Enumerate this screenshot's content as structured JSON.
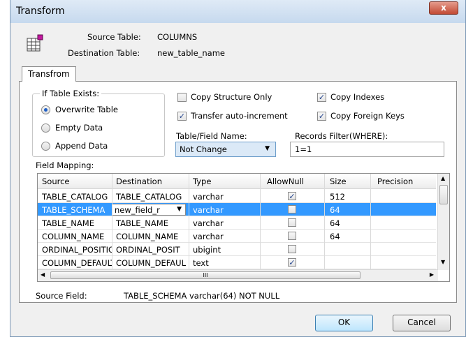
{
  "window": {
    "title": "Transform",
    "close_label": "x"
  },
  "header": {
    "source_label": "Source Table:",
    "source_value": "COLUMNS",
    "dest_label": "Destination Table:",
    "dest_value": "new_table_name"
  },
  "tab": {
    "label": "Transfrom"
  },
  "if_table_exists": {
    "legend": "If Table Exists:",
    "options": [
      {
        "label": "Overwrite Table",
        "selected": true
      },
      {
        "label": "Empty Data",
        "selected": false
      },
      {
        "label": "Append Data",
        "selected": false
      }
    ]
  },
  "checkboxes": {
    "copy_structure_only": {
      "label": "Copy Structure Only",
      "checked": false
    },
    "copy_indexes": {
      "label": "Copy Indexes",
      "checked": true
    },
    "transfer_auto_increment": {
      "label": "Transfer auto-increment",
      "checked": true
    },
    "copy_foreign_keys": {
      "label": "Copy Foreign Keys",
      "checked": true
    }
  },
  "name_field": {
    "label": "Table/Field Name:",
    "value": "Not Change"
  },
  "filter": {
    "label": "Records Filter(WHERE):",
    "value": "1=1"
  },
  "mapping": {
    "label": "Field Mapping:",
    "columns": [
      "Source",
      "Destination",
      "Type",
      "AllowNull",
      "Size",
      "Precision"
    ],
    "rows": [
      {
        "source": "TABLE_CATALOG",
        "destination": "TABLE_CATALOG",
        "type": "varchar",
        "allow_null": true,
        "size": "512",
        "precision": ""
      },
      {
        "source": "TABLE_SCHEMA",
        "destination": "new_field_r",
        "type": "varchar",
        "allow_null": false,
        "size": "64",
        "precision": ""
      },
      {
        "source": "TABLE_NAME",
        "destination": "TABLE_NAME",
        "type": "varchar",
        "allow_null": false,
        "size": "64",
        "precision": ""
      },
      {
        "source": "COLUMN_NAME",
        "destination": "COLUMN_NAME",
        "type": "varchar",
        "allow_null": false,
        "size": "64",
        "precision": ""
      },
      {
        "source": "ORDINAL_POSITION",
        "destination": "ORDINAL_POSIT",
        "type": "ubigint",
        "allow_null": false,
        "size": "",
        "precision": ""
      },
      {
        "source": "COLUMN_DEFAULT",
        "destination": "COLUMN_DEFAUL",
        "type": "text",
        "allow_null": true,
        "size": "",
        "precision": ""
      }
    ],
    "scroll_thumb_label": "III"
  },
  "source_field": {
    "label": "Source Field:",
    "value": "TABLE_SCHEMA varchar(64) NOT NULL"
  },
  "buttons": {
    "ok": "OK",
    "cancel": "Cancel"
  },
  "icons": {
    "table": "table-icon",
    "close": "close-icon"
  }
}
